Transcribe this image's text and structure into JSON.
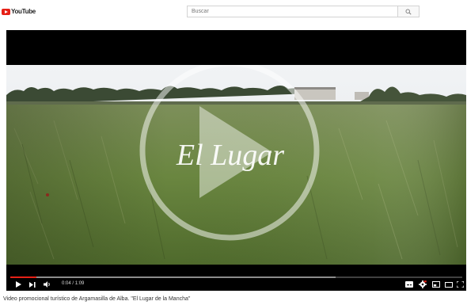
{
  "header": {
    "logo_text": "YouTube",
    "search_placeholder": "Buscar"
  },
  "video": {
    "overlay_title": "El Lugar",
    "time_current": "0:04",
    "time_separator": " / ",
    "time_total": "1:09",
    "progress": 0.058,
    "buffered": 0.72,
    "title": "Video promocional turístico de Argamasilla de Alba. \"El Lugar de la Mancha\""
  },
  "icons": {
    "play": "play-icon",
    "next": "next-icon",
    "volume": "volume-icon",
    "subtitles": "subtitles-icon",
    "settings": "settings-icon",
    "miniplayer": "miniplayer-icon",
    "theater": "theater-icon",
    "fullscreen": "fullscreen-icon"
  },
  "colors": {
    "brand": "#e62117",
    "field": "#6e8a3f",
    "sky": "#e9ecef"
  }
}
